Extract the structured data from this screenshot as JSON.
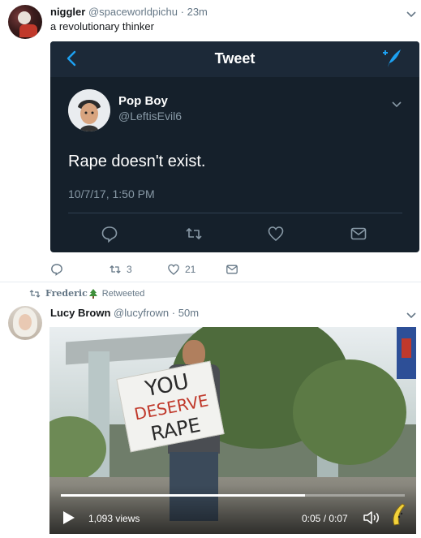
{
  "tweet1": {
    "display_name": "niggler",
    "handle": "@spaceworldpichu",
    "time": "23m",
    "text": "a revolutionary thinker",
    "actions": {
      "retweets": "3",
      "likes": "21"
    }
  },
  "embedded": {
    "header_title": "Tweet",
    "display_name": "Pop Boy",
    "handle": "@LeftisEvil6",
    "text": "Rape doesn't exist.",
    "timestamp": "10/7/17, 1:50 PM"
  },
  "retweet_context": {
    "retweeter": "Frederic",
    "label": "Retweeted"
  },
  "tweet2": {
    "display_name": "Lucy Brown",
    "handle": "@lucyfrown",
    "time": "50m",
    "video": {
      "views": "1,093 views",
      "time": "0:05 / 0:07",
      "progress": 0.71,
      "sign_lines": [
        "YOU",
        "DESERVE",
        "RAPE"
      ]
    }
  },
  "colors": {
    "embed_bg": "#15202b",
    "embed_header_bg": "#1c2938",
    "accent": "#1da1f2",
    "muted_text": "#657786"
  }
}
